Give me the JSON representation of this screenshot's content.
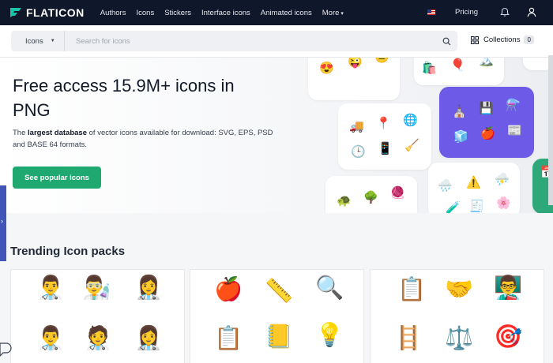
{
  "nav": {
    "logo": "FLATICON",
    "items": [
      "Authors",
      "Icons",
      "Stickers",
      "Interface icons",
      "Animated icons",
      "More"
    ],
    "pricing": "Pricing"
  },
  "search": {
    "category": "Icons",
    "placeholder": "Search for icons",
    "collections_label": "Collections",
    "collections_count": "0"
  },
  "hero": {
    "title": "Free access 15.9M+ icons in PNG",
    "desc_prefix": "The",
    "desc_bold": "largest database",
    "desc_rest": "of vector icons available for download: SVG, EPS, PSD and BASE 64 formats.",
    "cta": "See popular icons"
  },
  "trending": {
    "title": "Trending Icon packs",
    "packs": [
      {
        "icons": [
          "👨‍⚕️",
          "👨‍🔬",
          "👩‍⚕️",
          "👨‍⚕️",
          "🧑‍⚕️",
          "👩‍⚕️"
        ]
      },
      {
        "icons": [
          "🍎",
          "📏",
          "🔍",
          "📋",
          "📒",
          "💡"
        ]
      },
      {
        "icons": [
          "📋",
          "🤝",
          "👨‍🏫",
          "🪜",
          "⚖️",
          "🎯"
        ]
      }
    ]
  },
  "colors": {
    "nav_bg": "#0f172a",
    "accent": "#1fa971",
    "purple_card": "#6d5ae6"
  },
  "icons": [
    "logo-mark",
    "flag-us",
    "bell",
    "user",
    "search",
    "collections-grid",
    "chat-bubble"
  ]
}
